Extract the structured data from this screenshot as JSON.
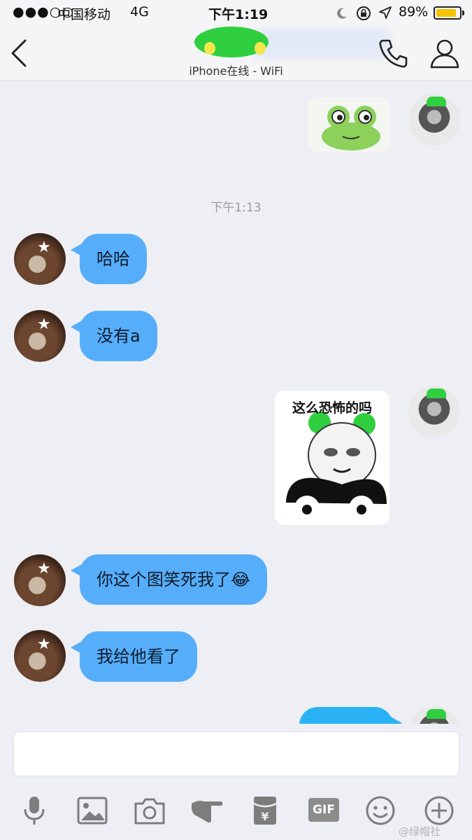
{
  "status_bar": {
    "signal": "●●●○○",
    "carrier": "中国移动",
    "network": "4G",
    "time": "下午1:19",
    "battery_percent": "89%",
    "battery_level": 0.89
  },
  "header": {
    "online_status": "iPhone在线 - WiFi"
  },
  "messages": {
    "timestamp": "下午1:13",
    "msg1": "哈哈",
    "msg2": "没有a",
    "sticker_caption": "这么恐怖的吗",
    "msg3": "你这个图笑死我了",
    "msg3_emoji": "😂",
    "msg4": "我给他看了"
  },
  "toolbar": {
    "gif_label": "GIF"
  },
  "watermark": "@绿帽社",
  "colors": {
    "incoming_bubble": "#56aefa",
    "outgoing_bubble": "#2ab3f4",
    "green_mark": "#2fcf3f"
  }
}
